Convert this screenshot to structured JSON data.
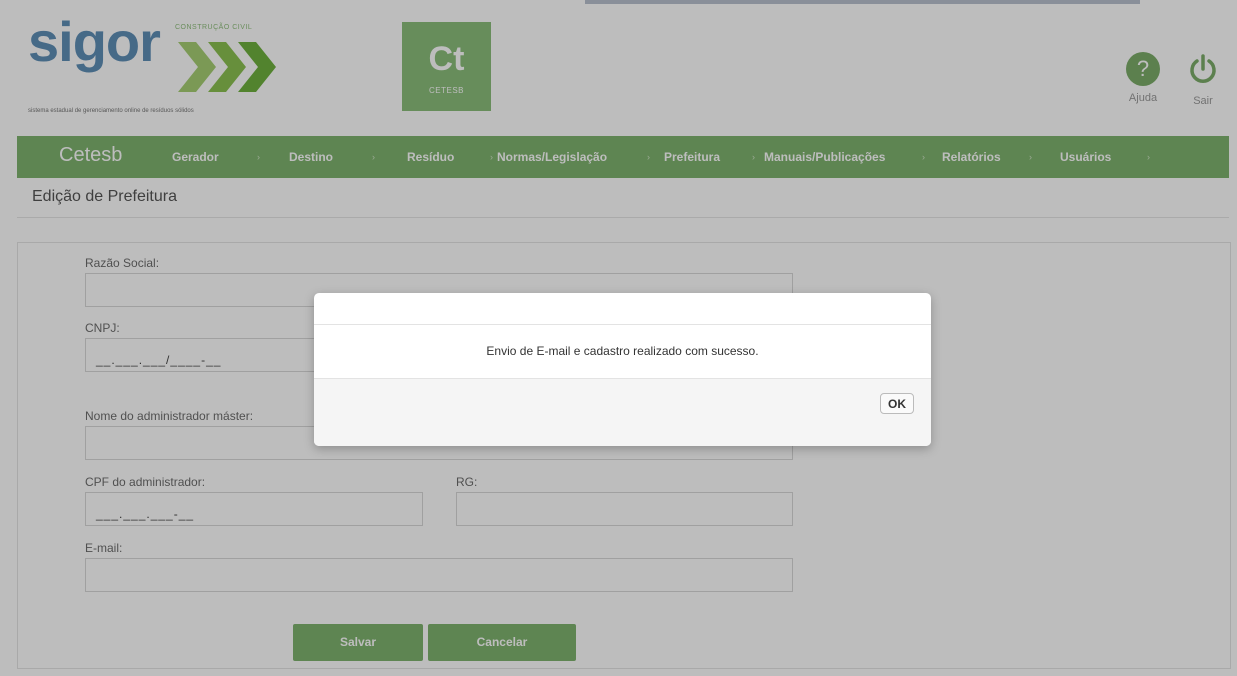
{
  "header": {
    "logo_text": "sigor",
    "logo_tagline": "CONSTRUÇÃO CIVIL",
    "logo_subtitle": "sistema estadual de gerenciamento online de resíduos sólidos",
    "agency_logo": "Ct",
    "agency_name": "CETESB",
    "help_label": "Ajuda",
    "logout_label": "Sair",
    "help_icon": "question-circle-icon",
    "logout_icon": "power-icon"
  },
  "nav": {
    "brand": "Cetesb",
    "items": [
      {
        "label": "Gerador"
      },
      {
        "label": "Destino"
      },
      {
        "label": "Resíduo"
      },
      {
        "label": "Normas/Legislação"
      },
      {
        "label": "Prefeitura"
      },
      {
        "label": "Manuais/Publicações"
      },
      {
        "label": "Relatórios"
      },
      {
        "label": "Usuários"
      }
    ]
  },
  "page": {
    "title": "Edição de Prefeitura"
  },
  "form": {
    "razao_social": {
      "label": "Razão Social:",
      "value": ""
    },
    "cnpj": {
      "label": "CNPJ:",
      "value": "__.___.___/____-__"
    },
    "admin_name": {
      "label": "Nome do administrador máster:",
      "value": ""
    },
    "admin_cpf": {
      "label": "CPF do administrador:",
      "value": "___.___.___-__"
    },
    "rg": {
      "label": "RG:",
      "value": ""
    },
    "email": {
      "label": "E-mail:",
      "value": ""
    },
    "save_label": "Salvar",
    "cancel_label": "Cancelar"
  },
  "modal": {
    "message": "Envio de E-mail e cadastro realizado com sucesso.",
    "ok_label": "OK"
  },
  "colors": {
    "accent_green": "#7fb46f",
    "logo_blue": "#5f8fb7"
  }
}
